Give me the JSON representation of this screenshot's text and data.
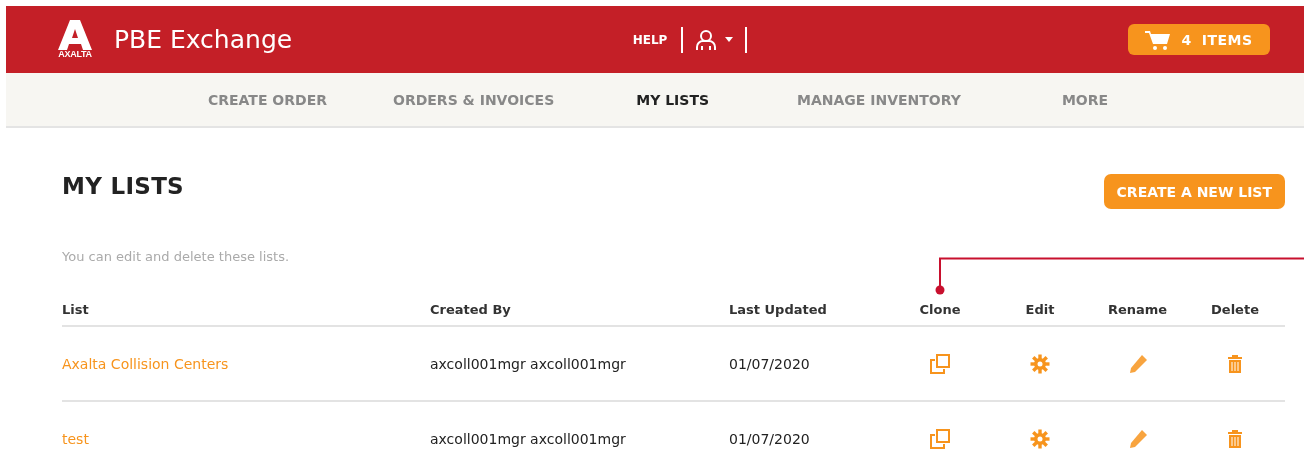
{
  "header": {
    "logo_text": "AXALTA",
    "title": "PBE Exchange",
    "help": "HELP",
    "cart": {
      "count": "4",
      "label": "ITEMS"
    }
  },
  "nav": [
    {
      "label": "CREATE ORDER",
      "selected": false
    },
    {
      "label": "ORDERS & INVOICES",
      "selected": false
    },
    {
      "label": "MY LISTS",
      "selected": true
    },
    {
      "label": "MANAGE INVENTORY",
      "selected": false
    },
    {
      "label": "MORE",
      "selected": false
    }
  ],
  "page": {
    "title": "MY LISTS",
    "create_button": "CREATE A NEW LIST",
    "hint": "You can edit and delete these lists."
  },
  "table": {
    "columns": [
      "List",
      "Created By",
      "Last Updated",
      "Clone",
      "Edit",
      "Rename",
      "Delete"
    ],
    "rows": [
      {
        "list": "Axalta Collision Centers",
        "created_by": "axcoll001mgr axcoll001mgr",
        "last_updated": "01/07/2020"
      },
      {
        "list": "test",
        "created_by": "axcoll001mgr axcoll001mgr",
        "last_updated": "01/07/2020"
      }
    ]
  }
}
